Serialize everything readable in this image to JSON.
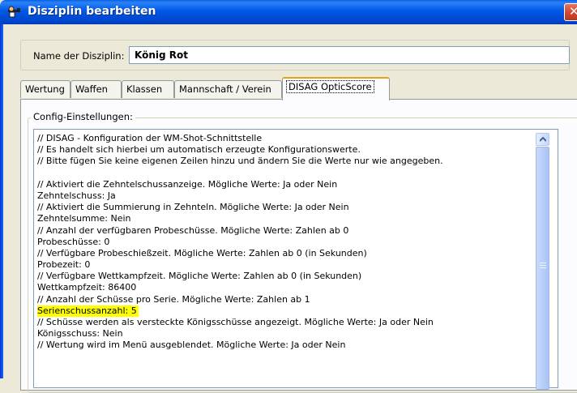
{
  "window": {
    "title": "Disziplin bearbeiten",
    "icon": "shooter-icon",
    "close_glyph": "✕"
  },
  "name": {
    "label": "Name der Disziplin:",
    "value": "König Rot"
  },
  "tabs": [
    {
      "label": "Wertung"
    },
    {
      "label": "Waffen"
    },
    {
      "label": "Klassen"
    },
    {
      "label": "Mannschaft / Verein"
    },
    {
      "label": "DISAG OpticScore"
    }
  ],
  "active_tab": "DISAG OpticScore",
  "config": {
    "legend": "Config-Einstellungen:",
    "lines": [
      "// DISAG - Konfiguration der WM-Shot-Schnittstelle",
      "// Es handelt sich hierbei um automatisch erzeugte Konfigurationswerte.",
      "// Bitte fügen Sie keine eigenen Zeilen hinzu und ändern Sie die Werte nur wie angegeben.",
      "",
      "// Aktiviert die Zehntelschussanzeige. Mögliche Werte: Ja oder Nein",
      "Zehntelschuss: Ja",
      "// Aktiviert die Summierung in Zehnteln. Mögliche Werte: Ja oder Nein",
      "Zehntelsumme: Nein",
      "// Anzahl der verfügbaren Probeschüsse. Mögliche Werte: Zahlen ab 0",
      "Probeschüsse: 0",
      "// Verfügbare Probeschießzeit. Mögliche Werte: Zahlen ab 0 (in Sekunden)",
      "Probezeit: 0",
      "// Verfügbare Wettkampfzeit. Mögliche Werte: Zahlen ab 0 (in Sekunden)",
      "Wettkampfzeit: 86400",
      "// Anzahl der Schüsse pro Serie. Mögliche Werte: Zahlen ab 1",
      "Serienschussanzahl: 5",
      "// Schüsse werden als versteckte Königsschüsse angezeigt. Mögliche Werte: Ja oder Nein",
      "Königsschuss: Nein",
      "// Wertung wird im Menü ausgeblendet. Mögliche Werte: Ja oder Nein"
    ],
    "highlighted_line": "Serienschussanzahl: 5",
    "highlight_color": "#ffff00"
  },
  "colors": {
    "titlebar": "#0058e6",
    "dialog_bg": "#ece9d8",
    "active_tab_accent": "#e3a21a"
  }
}
